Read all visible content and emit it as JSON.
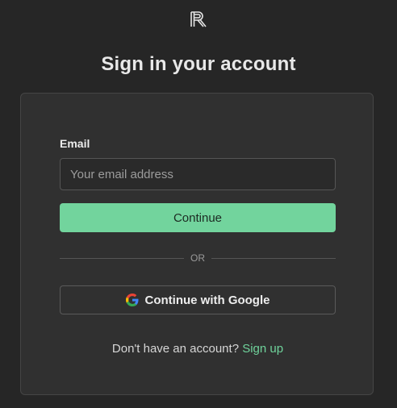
{
  "logo": {
    "icon": "r-logo-icon"
  },
  "heading": {
    "title": "Sign in your account"
  },
  "form": {
    "email_label": "Email",
    "email_value": "",
    "email_placeholder": "Your email address",
    "continue_label": "Continue",
    "or_label": "OR",
    "google_label": "Continue with Google",
    "google_icon": "google-icon"
  },
  "footer": {
    "prompt": "Don't have an account?",
    "signup_label": "Sign up"
  },
  "colors": {
    "background": "#262626",
    "card": "#303030",
    "accent": "#72d49d",
    "link": "#6fd39b"
  }
}
